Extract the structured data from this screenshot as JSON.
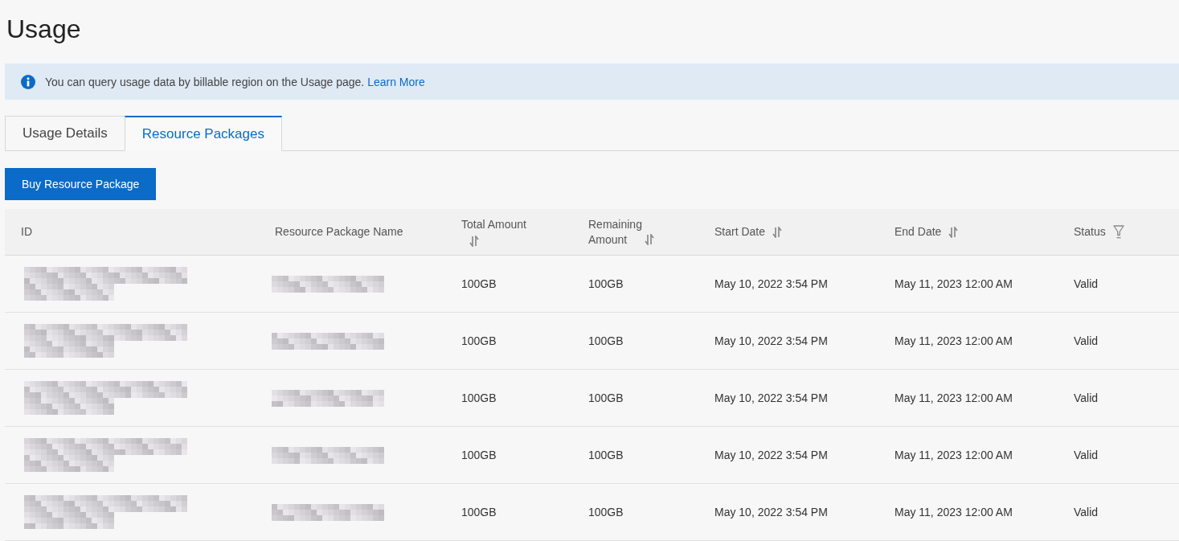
{
  "page": {
    "title": "Usage"
  },
  "notice": {
    "text": "You can query usage data by billable region on the Usage page.",
    "link": "Learn More"
  },
  "tabs": [
    {
      "label": "Usage Details",
      "selected": false
    },
    {
      "label": "Resource Packages",
      "selected": true
    }
  ],
  "actions": {
    "buy_button": "Buy Resource Package"
  },
  "table": {
    "columns": [
      {
        "label": "ID",
        "sortable": false,
        "filterable": false
      },
      {
        "label": "Resource Package Name",
        "sortable": false,
        "filterable": false
      },
      {
        "label": "Total Amount",
        "sortable": true,
        "filterable": false
      },
      {
        "label": "Remaining Amount",
        "sortable": true,
        "filterable": false
      },
      {
        "label": "Start Date",
        "sortable": true,
        "filterable": false
      },
      {
        "label": "End Date",
        "sortable": true,
        "filterable": false
      },
      {
        "label": "Status",
        "sortable": false,
        "filterable": true
      }
    ],
    "rows": [
      {
        "total_amount": "100GB",
        "remaining_amount": "100GB",
        "start_date": "May 10, 2022 3:54 PM",
        "end_date": "May 11, 2023 12:00 AM",
        "status": "Valid"
      },
      {
        "total_amount": "100GB",
        "remaining_amount": "100GB",
        "start_date": "May 10, 2022 3:54 PM",
        "end_date": "May 11, 2023 12:00 AM",
        "status": "Valid"
      },
      {
        "total_amount": "100GB",
        "remaining_amount": "100GB",
        "start_date": "May 10, 2022 3:54 PM",
        "end_date": "May 11, 2023 12:00 AM",
        "status": "Valid"
      },
      {
        "total_amount": "100GB",
        "remaining_amount": "100GB",
        "start_date": "May 10, 2022 3:54 PM",
        "end_date": "May 11, 2023 12:00 AM",
        "status": "Valid"
      },
      {
        "total_amount": "100GB",
        "remaining_amount": "100GB",
        "start_date": "May 10, 2022 3:54 PM",
        "end_date": "May 11, 2023 12:00 AM",
        "status": "Valid"
      }
    ]
  }
}
